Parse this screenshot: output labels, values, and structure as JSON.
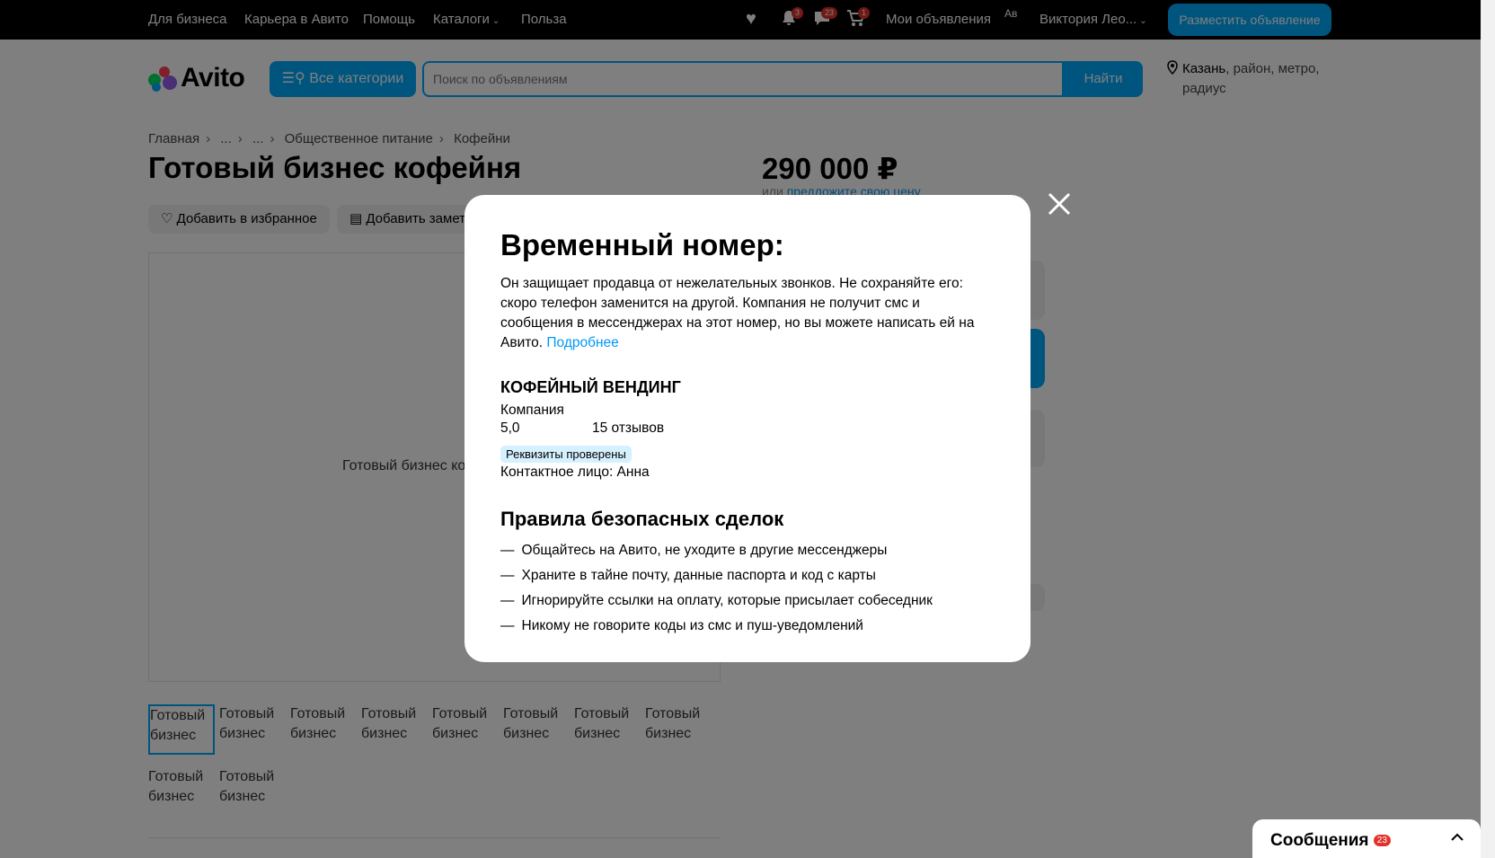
{
  "topbar": {
    "links": [
      "Для бизнеса",
      "Карьера в Авито",
      "Помощь",
      "Каталоги",
      "Польза"
    ],
    "notifications_count": "3",
    "messages_count": "23",
    "cart_count": "1",
    "my_ads": "Мои объявления",
    "avatar_alt": "Ав",
    "user_name": "Виктория Лео...",
    "post_button": "Разместить объявление"
  },
  "header": {
    "logo_text": "Avito",
    "categories_button": "Все категории",
    "search_placeholder": "Поиск по объявлениям",
    "search_button": "Найти",
    "location_city": "Казань",
    "location_rest": ", район, метро, радиус"
  },
  "listing": {
    "breadcrumbs": [
      "Главная",
      "...",
      "...",
      "Общественное питание",
      "Кофейни"
    ],
    "title": "Готовый бизнес кофейня",
    "price": "290 000 ₽",
    "offer_prefix": "или ",
    "offer_link": "предложите свою цену",
    "favorite_button": "Добавить в избранное",
    "note_button": "Добавить заметку",
    "image_alt": "Готовый бизнес кофейня",
    "thumb_alt": "Готовый бизнес"
  },
  "modal": {
    "title": "Временный номер:",
    "description": "Он защищает продавца от нежелательных звонков. Не сохраняйте его: скоро телефон заменится на другой. Компания не получит смс и сообщения в мессенджерах на этот номер, но вы можете написать ей на Авито.",
    "more_link": "Подробнее",
    "seller_name": "КОФЕЙНЫЙ ВЕНДИНГ",
    "seller_type": "Компания",
    "rating": "5,0",
    "reviews": "15 отзывов",
    "verified_badge": "Реквизиты проверены",
    "contact": "Контактное лицо: Анна",
    "rules_title": "Правила безопасных сделок",
    "rules": [
      "Общайтесь на Авито, не уходите в другие мессенджеры",
      "Храните в тайне почту, данные паспорта и код с карты",
      "Игнорируйте ссылки на оплату, которые присылает собеседник",
      "Никому не говорите коды из смс и пуш-уведомлений"
    ]
  },
  "messages_widget": {
    "label": "Сообщения",
    "count": "23"
  },
  "colors": {
    "accent": "#00aaff",
    "badge": "#e2322d",
    "verified_bg": "#d5f0ff"
  },
  "icons": [
    "heart-icon",
    "bell-icon",
    "chat-icon",
    "cart-icon",
    "search-icon",
    "location-pin-icon",
    "close-icon",
    "chevron-down-icon",
    "chevron-up-icon"
  ]
}
